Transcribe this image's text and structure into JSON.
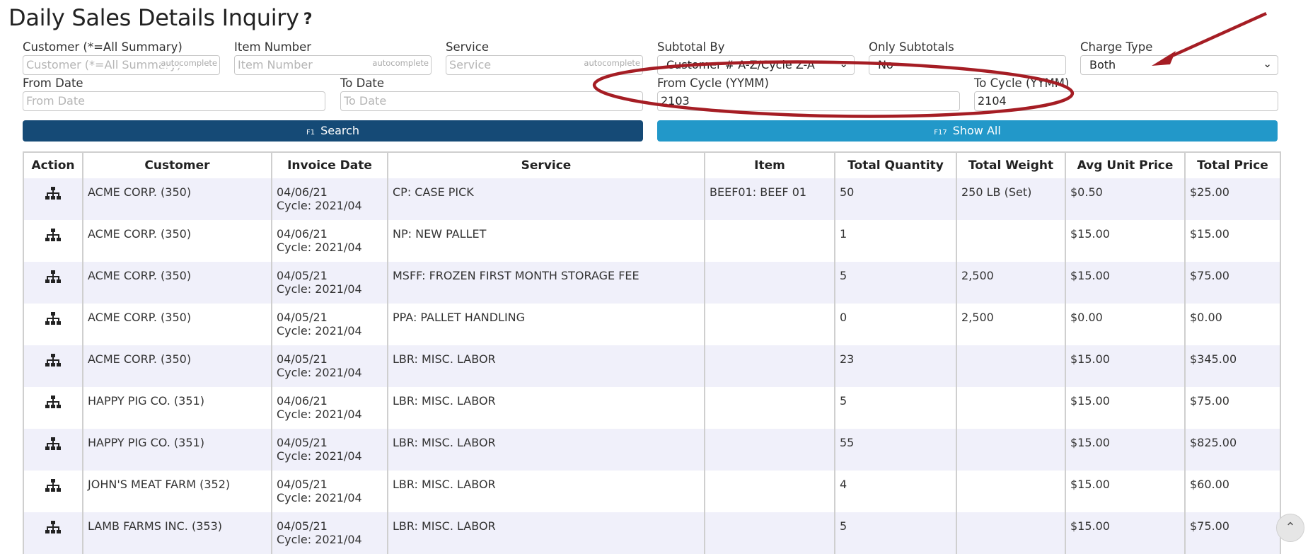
{
  "page": {
    "title": "Daily Sales Details Inquiry",
    "help_icon": "?"
  },
  "filters": {
    "customer": {
      "label": "Customer (*=All Summary)",
      "placeholder": "Customer (*=All Summary)",
      "tag": "autocomplete"
    },
    "item_number": {
      "label": "Item Number",
      "placeholder": "Item Number",
      "tag": "autocomplete"
    },
    "service": {
      "label": "Service",
      "placeholder": "Service",
      "tag": "autocomplete"
    },
    "subtotal_by": {
      "label": "Subtotal By",
      "value": "Customer # A-Z/Cycle Z-A"
    },
    "only_subtotals": {
      "label": "Only Subtotals",
      "value": "No"
    },
    "charge_type": {
      "label": "Charge Type",
      "value": "Both"
    },
    "from_date": {
      "label": "From Date",
      "placeholder": "From Date"
    },
    "to_date": {
      "label": "To Date",
      "placeholder": "To Date"
    },
    "from_cycle": {
      "label": "From Cycle (YYMM)",
      "value": "2103"
    },
    "to_cycle": {
      "label": "To Cycle (YYMM)",
      "value": "2104"
    }
  },
  "buttons": {
    "search": {
      "fkey": "F1",
      "label": "Search"
    },
    "show_all": {
      "fkey": "F17",
      "label": "Show All"
    }
  },
  "table": {
    "headers": [
      "Action",
      "Customer",
      "Invoice Date",
      "Service",
      "Item",
      "Total Quantity",
      "Total Weight",
      "Avg Unit Price",
      "Total Price"
    ],
    "rows": [
      {
        "customer": "ACME CORP. (350)",
        "date": "04/06/21",
        "cycle": "Cycle: 2021/04",
        "service": "CP: CASE PICK",
        "item": "BEEF01: BEEF 01",
        "qty": "50",
        "weight": "250 LB (Set)",
        "avg": "$0.50",
        "total": "$25.00"
      },
      {
        "customer": "ACME CORP. (350)",
        "date": "04/06/21",
        "cycle": "Cycle: 2021/04",
        "service": "NP: NEW PALLET",
        "item": "",
        "qty": "1",
        "weight": "",
        "avg": "$15.00",
        "total": "$15.00"
      },
      {
        "customer": "ACME CORP. (350)",
        "date": "04/05/21",
        "cycle": "Cycle: 2021/04",
        "service": "MSFF: FROZEN FIRST MONTH STORAGE FEE",
        "item": "",
        "qty": "5",
        "weight": "2,500",
        "avg": "$15.00",
        "total": "$75.00"
      },
      {
        "customer": "ACME CORP. (350)",
        "date": "04/05/21",
        "cycle": "Cycle: 2021/04",
        "service": "PPA: PALLET HANDLING",
        "item": "",
        "qty": "0",
        "weight": "2,500",
        "avg": "$0.00",
        "total": "$0.00"
      },
      {
        "customer": "ACME CORP. (350)",
        "date": "04/05/21",
        "cycle": "Cycle: 2021/04",
        "service": "LBR: MISC. LABOR",
        "item": "",
        "qty": "23",
        "weight": "",
        "avg": "$15.00",
        "total": "$345.00"
      },
      {
        "customer": "HAPPY PIG CO. (351)",
        "date": "04/06/21",
        "cycle": "Cycle: 2021/04",
        "service": "LBR: MISC. LABOR",
        "item": "",
        "qty": "5",
        "weight": "",
        "avg": "$15.00",
        "total": "$75.00"
      },
      {
        "customer": "HAPPY PIG CO. (351)",
        "date": "04/05/21",
        "cycle": "Cycle: 2021/04",
        "service": "LBR: MISC. LABOR",
        "item": "",
        "qty": "55",
        "weight": "",
        "avg": "$15.00",
        "total": "$825.00"
      },
      {
        "customer": "JOHN'S MEAT FARM (352)",
        "date": "04/05/21",
        "cycle": "Cycle: 2021/04",
        "service": "LBR: MISC. LABOR",
        "item": "",
        "qty": "4",
        "weight": "",
        "avg": "$15.00",
        "total": "$60.00"
      },
      {
        "customer": "LAMB FARMS INC. (353)",
        "date": "04/05/21",
        "cycle": "Cycle: 2021/04",
        "service": "LBR: MISC. LABOR",
        "item": "",
        "qty": "5",
        "weight": "",
        "avg": "$15.00",
        "total": "$75.00"
      }
    ]
  },
  "colors": {
    "search_button": "#154a76",
    "show_all_button": "#2298c9",
    "annotation": "#a51d24",
    "row_stripe": "#f0f0fa"
  },
  "icons": {
    "action": "sitemap-icon",
    "scroll_top": "chevron-up-icon",
    "select": "chevron-down-icon"
  }
}
